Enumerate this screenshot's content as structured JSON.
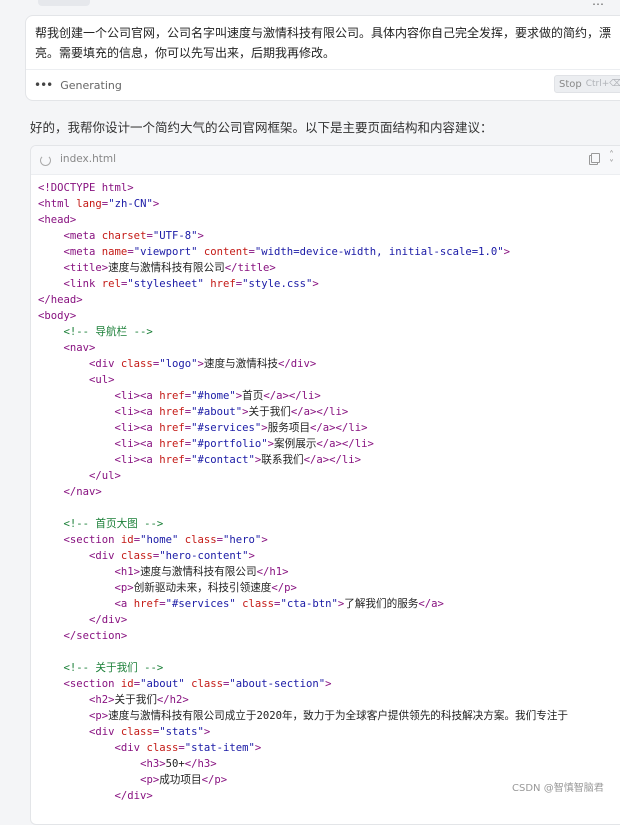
{
  "prompt": {
    "text": "帮我创建一个公司官网，公司名字叫速度与激情科技有限公司。具体内容你自己完全发挥，要求做的简约，漂亮。需要填充的信息，你可以先写出来，后期我再修改。",
    "status": "Generating",
    "stop_label": "Stop",
    "stop_shortcut": "Ctrl+⌫"
  },
  "answer": {
    "text": "好的，我帮你设计一个简约大气的公司官网框架。以下是主要页面结构和内容建议："
  },
  "code_block": {
    "filename": "index.html",
    "lines": [
      [
        [
          "t",
          "<!DOCTYPE html>"
        ]
      ],
      [
        [
          "t",
          "<html "
        ],
        [
          "a",
          "lang"
        ],
        [
          "t",
          "="
        ],
        [
          "v",
          "\"zh-CN\""
        ],
        [
          "t",
          ">"
        ]
      ],
      [
        [
          "t",
          "<head>"
        ]
      ],
      [
        [
          "p",
          "    "
        ],
        [
          "t",
          "<meta "
        ],
        [
          "a",
          "charset"
        ],
        [
          "t",
          "="
        ],
        [
          "v",
          "\"UTF-8\""
        ],
        [
          "t",
          ">"
        ]
      ],
      [
        [
          "p",
          "    "
        ],
        [
          "t",
          "<meta "
        ],
        [
          "a",
          "name"
        ],
        [
          "t",
          "="
        ],
        [
          "v",
          "\"viewport\""
        ],
        [
          "p",
          " "
        ],
        [
          "a",
          "content"
        ],
        [
          "t",
          "="
        ],
        [
          "v",
          "\"width=device-width, initial-scale=1.0\""
        ],
        [
          "t",
          ">"
        ]
      ],
      [
        [
          "p",
          "    "
        ],
        [
          "t",
          "<title>"
        ],
        [
          "p",
          "速度与激情科技有限公司"
        ],
        [
          "t",
          "</title>"
        ]
      ],
      [
        [
          "p",
          "    "
        ],
        [
          "t",
          "<link "
        ],
        [
          "a",
          "rel"
        ],
        [
          "t",
          "="
        ],
        [
          "v",
          "\"stylesheet\""
        ],
        [
          "p",
          " "
        ],
        [
          "a",
          "href"
        ],
        [
          "t",
          "="
        ],
        [
          "v",
          "\"style.css\""
        ],
        [
          "t",
          ">"
        ]
      ],
      [
        [
          "t",
          "</head>"
        ]
      ],
      [
        [
          "t",
          "<body>"
        ]
      ],
      [
        [
          "p",
          "    "
        ],
        [
          "c",
          "<!-- 导航栏 -->"
        ]
      ],
      [
        [
          "p",
          "    "
        ],
        [
          "t",
          "<nav>"
        ]
      ],
      [
        [
          "p",
          "        "
        ],
        [
          "t",
          "<div "
        ],
        [
          "a",
          "class"
        ],
        [
          "t",
          "="
        ],
        [
          "v",
          "\"logo\""
        ],
        [
          "t",
          ">"
        ],
        [
          "p",
          "速度与激情科技"
        ],
        [
          "t",
          "</div>"
        ]
      ],
      [
        [
          "p",
          "        "
        ],
        [
          "t",
          "<ul>"
        ]
      ],
      [
        [
          "p",
          "            "
        ],
        [
          "t",
          "<li><a "
        ],
        [
          "a",
          "href"
        ],
        [
          "t",
          "="
        ],
        [
          "v",
          "\"#home\""
        ],
        [
          "t",
          ">"
        ],
        [
          "p",
          "首页"
        ],
        [
          "t",
          "</a></li>"
        ]
      ],
      [
        [
          "p",
          "            "
        ],
        [
          "t",
          "<li><a "
        ],
        [
          "a",
          "href"
        ],
        [
          "t",
          "="
        ],
        [
          "v",
          "\"#about\""
        ],
        [
          "t",
          ">"
        ],
        [
          "p",
          "关于我们"
        ],
        [
          "t",
          "</a></li>"
        ]
      ],
      [
        [
          "p",
          "            "
        ],
        [
          "t",
          "<li><a "
        ],
        [
          "a",
          "href"
        ],
        [
          "t",
          "="
        ],
        [
          "v",
          "\"#services\""
        ],
        [
          "t",
          ">"
        ],
        [
          "p",
          "服务项目"
        ],
        [
          "t",
          "</a></li>"
        ]
      ],
      [
        [
          "p",
          "            "
        ],
        [
          "t",
          "<li><a "
        ],
        [
          "a",
          "href"
        ],
        [
          "t",
          "="
        ],
        [
          "v",
          "\"#portfolio\""
        ],
        [
          "t",
          ">"
        ],
        [
          "p",
          "案例展示"
        ],
        [
          "t",
          "</a></li>"
        ]
      ],
      [
        [
          "p",
          "            "
        ],
        [
          "t",
          "<li><a "
        ],
        [
          "a",
          "href"
        ],
        [
          "t",
          "="
        ],
        [
          "v",
          "\"#contact\""
        ],
        [
          "t",
          ">"
        ],
        [
          "p",
          "联系我们"
        ],
        [
          "t",
          "</a></li>"
        ]
      ],
      [
        [
          "p",
          "        "
        ],
        [
          "t",
          "</ul>"
        ]
      ],
      [
        [
          "p",
          "    "
        ],
        [
          "t",
          "</nav>"
        ]
      ],
      [
        [
          "p",
          ""
        ]
      ],
      [
        [
          "p",
          "    "
        ],
        [
          "c",
          "<!-- 首页大图 -->"
        ]
      ],
      [
        [
          "p",
          "    "
        ],
        [
          "t",
          "<section "
        ],
        [
          "a",
          "id"
        ],
        [
          "t",
          "="
        ],
        [
          "v",
          "\"home\""
        ],
        [
          "p",
          " "
        ],
        [
          "a",
          "class"
        ],
        [
          "t",
          "="
        ],
        [
          "v",
          "\"hero\""
        ],
        [
          "t",
          ">"
        ]
      ],
      [
        [
          "p",
          "        "
        ],
        [
          "t",
          "<div "
        ],
        [
          "a",
          "class"
        ],
        [
          "t",
          "="
        ],
        [
          "v",
          "\"hero-content\""
        ],
        [
          "t",
          ">"
        ]
      ],
      [
        [
          "p",
          "            "
        ],
        [
          "t",
          "<h1>"
        ],
        [
          "p",
          "速度与激情科技有限公司"
        ],
        [
          "t",
          "</h1>"
        ]
      ],
      [
        [
          "p",
          "            "
        ],
        [
          "t",
          "<p>"
        ],
        [
          "p",
          "创新驱动未来，科技引领速度"
        ],
        [
          "t",
          "</p>"
        ]
      ],
      [
        [
          "p",
          "            "
        ],
        [
          "t",
          "<a "
        ],
        [
          "a",
          "href"
        ],
        [
          "t",
          "="
        ],
        [
          "v",
          "\"#services\""
        ],
        [
          "p",
          " "
        ],
        [
          "a",
          "class"
        ],
        [
          "t",
          "="
        ],
        [
          "v",
          "\"cta-btn\""
        ],
        [
          "t",
          ">"
        ],
        [
          "p",
          "了解我们的服务"
        ],
        [
          "t",
          "</a>"
        ]
      ],
      [
        [
          "p",
          "        "
        ],
        [
          "t",
          "</div>"
        ]
      ],
      [
        [
          "p",
          "    "
        ],
        [
          "t",
          "</section>"
        ]
      ],
      [
        [
          "p",
          ""
        ]
      ],
      [
        [
          "p",
          "    "
        ],
        [
          "c",
          "<!-- 关于我们 -->"
        ]
      ],
      [
        [
          "p",
          "    "
        ],
        [
          "t",
          "<section "
        ],
        [
          "a",
          "id"
        ],
        [
          "t",
          "="
        ],
        [
          "v",
          "\"about\""
        ],
        [
          "p",
          " "
        ],
        [
          "a",
          "class"
        ],
        [
          "t",
          "="
        ],
        [
          "v",
          "\"about-section\""
        ],
        [
          "t",
          ">"
        ]
      ],
      [
        [
          "p",
          "        "
        ],
        [
          "t",
          "<h2>"
        ],
        [
          "p",
          "关于我们"
        ],
        [
          "t",
          "</h2>"
        ]
      ],
      [
        [
          "p",
          "        "
        ],
        [
          "t",
          "<p>"
        ],
        [
          "p",
          "速度与激情科技有限公司成立于2020年，致力于为全球客户提供领先的科技解决方案。我们专注于"
        ]
      ],
      [
        [
          "p",
          "        "
        ],
        [
          "t",
          "<div "
        ],
        [
          "a",
          "class"
        ],
        [
          "t",
          "="
        ],
        [
          "v",
          "\"stats\""
        ],
        [
          "t",
          ">"
        ]
      ],
      [
        [
          "p",
          "            "
        ],
        [
          "t",
          "<div "
        ],
        [
          "a",
          "class"
        ],
        [
          "t",
          "="
        ],
        [
          "v",
          "\"stat-item\""
        ],
        [
          "t",
          ">"
        ]
      ],
      [
        [
          "p",
          "                "
        ],
        [
          "t",
          "<h3>"
        ],
        [
          "p",
          "50+"
        ],
        [
          "t",
          "</h3>"
        ]
      ],
      [
        [
          "p",
          "                "
        ],
        [
          "t",
          "<p>"
        ],
        [
          "p",
          "成功项目"
        ],
        [
          "t",
          "</p>"
        ]
      ],
      [
        [
          "p",
          "            "
        ],
        [
          "t",
          "</div>"
        ]
      ]
    ]
  },
  "watermark": "CSDN @智慎智脑君"
}
